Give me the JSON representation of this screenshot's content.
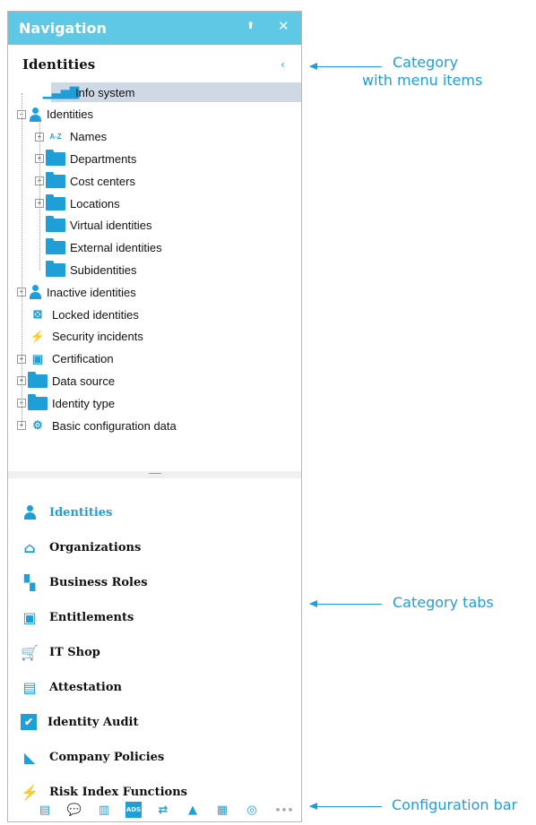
{
  "navigation": {
    "title": "Navigation",
    "pin_glyph": "⬆",
    "close_glyph": "✕"
  },
  "category": {
    "title": "Identities",
    "collapse_glyph": "‹"
  },
  "tree": [
    {
      "label": "Info system",
      "icon": "bar-chart-icon",
      "selected": true
    },
    {
      "label": "Identities",
      "icon": "person-icon",
      "expandable": true,
      "expanded": true
    },
    {
      "label": "Names",
      "icon": "alphabet-list-icon",
      "expandable": true
    },
    {
      "label": "Departments",
      "icon": "folder-icon",
      "expandable": true
    },
    {
      "label": "Cost centers",
      "icon": "folder-icon",
      "expandable": true
    },
    {
      "label": "Locations",
      "icon": "folder-icon",
      "expandable": true
    },
    {
      "label": "Virtual identities",
      "icon": "folder-icon"
    },
    {
      "label": "External identities",
      "icon": "folder-icon"
    },
    {
      "label": "Subidentities",
      "icon": "folder-icon"
    },
    {
      "label": "Inactive identities",
      "icon": "person-icon",
      "expandable": true
    },
    {
      "label": "Locked identities",
      "icon": "locked-person-icon"
    },
    {
      "label": "Security incidents",
      "icon": "lightning-icon"
    },
    {
      "label": "Certification",
      "icon": "certificate-icon",
      "expandable": true
    },
    {
      "label": "Data source",
      "icon": "folder-icon",
      "expandable": true
    },
    {
      "label": "Identity type",
      "icon": "folder-icon",
      "expandable": true
    },
    {
      "label": "Basic configuration data",
      "icon": "gears-icon",
      "expandable": true
    }
  ],
  "tabs": [
    {
      "label": "Identities",
      "icon": "person-icon",
      "active": true
    },
    {
      "label": "Organizations",
      "icon": "building-icon"
    },
    {
      "label": "Business Roles",
      "icon": "hierarchy-icon"
    },
    {
      "label": "Entitlements",
      "icon": "entitlement-icon"
    },
    {
      "label": "IT Shop",
      "icon": "shopping-cart-icon"
    },
    {
      "label": "Attestation",
      "icon": "attestation-icon"
    },
    {
      "label": "Identity Audit",
      "icon": "checkbox-icon"
    },
    {
      "label": "Company Policies",
      "icon": "policy-icon"
    },
    {
      "label": "Risk Index Functions",
      "icon": "lightning-icon"
    }
  ],
  "config_bar": [
    {
      "icon": "list-icon",
      "glyph": "▤"
    },
    {
      "icon": "chat-icon",
      "glyph": "💬"
    },
    {
      "icon": "columns-icon",
      "glyph": "▥"
    },
    {
      "icon": "ads-icon",
      "glyph": "ADS"
    },
    {
      "icon": "sync-icon",
      "glyph": "⇄"
    },
    {
      "icon": "triangle-icon",
      "glyph": "▲"
    },
    {
      "icon": "server-icon",
      "glyph": "▦"
    },
    {
      "icon": "target-icon",
      "glyph": "◎"
    },
    {
      "icon": "more-icon",
      "glyph": "•••"
    }
  ],
  "callouts": {
    "category_line1": "Category",
    "category_line2": "with menu items",
    "tabs": "Category tabs",
    "configbar": "Configuration bar"
  },
  "colors": {
    "accent": "#1f9fd8",
    "titlebar": "#5ec8e5",
    "selection": "#cfd9e6"
  }
}
